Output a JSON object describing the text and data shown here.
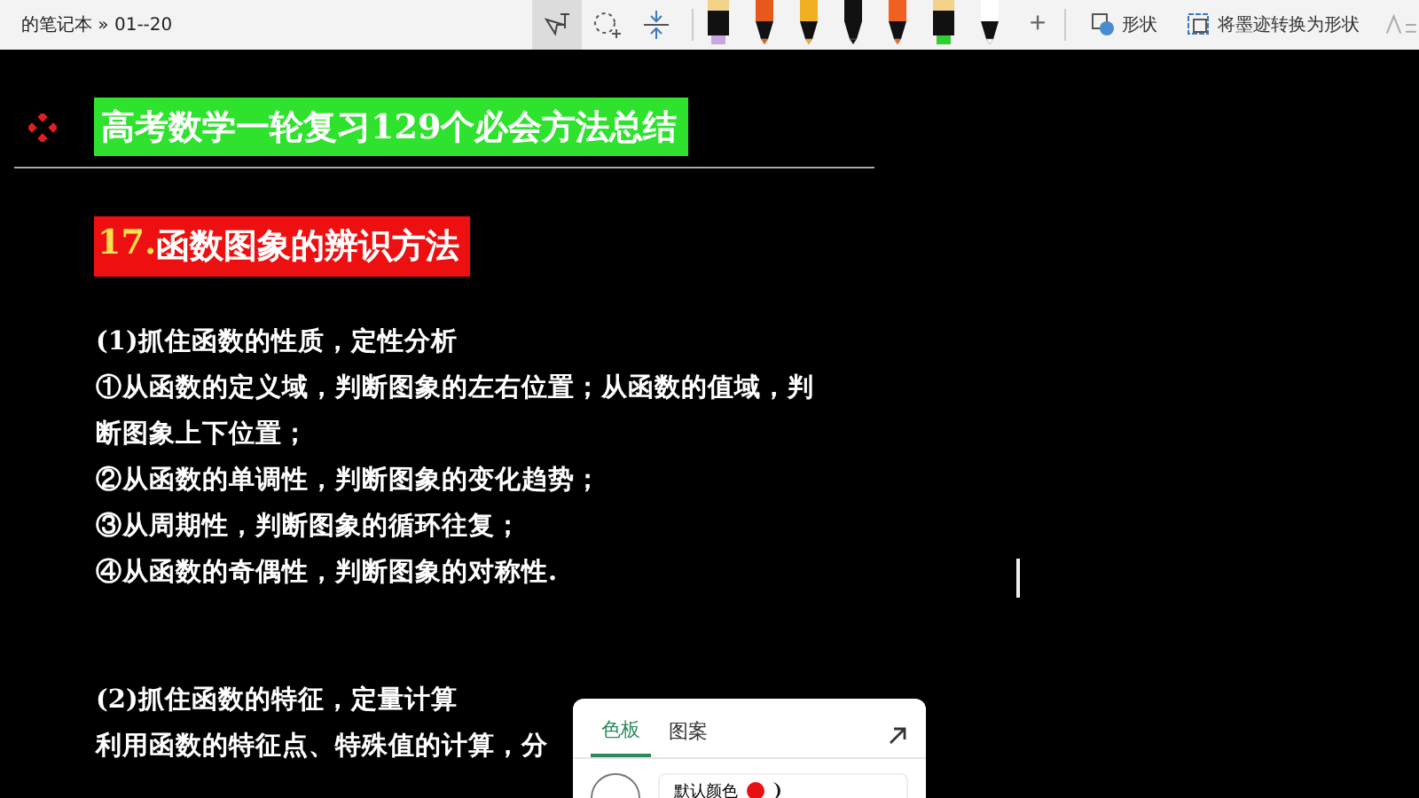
{
  "breadcrumb": "的笔记本 » 01--20",
  "tools": [
    {
      "kind": "ink-text",
      "selected": true
    },
    {
      "kind": "lasso",
      "selected": false
    },
    {
      "kind": "space",
      "selected": false
    }
  ],
  "pens": [
    {
      "kind": "highlighter",
      "color": "#c9a6e0"
    },
    {
      "kind": "pen",
      "color": "#e8581a"
    },
    {
      "kind": "pen",
      "color": "#f0b020"
    },
    {
      "kind": "pen",
      "color": "#111111"
    },
    {
      "kind": "pen",
      "color": "#f06020"
    },
    {
      "kind": "highlighter",
      "color": "#2ecf2e"
    },
    {
      "kind": "pen",
      "color": "#ffffff"
    }
  ],
  "add_pen": "+",
  "shape_button": "形状",
  "convert_button": "将墨迹转换为形状",
  "heading": "高考数学一轮复习129个必会方法总结",
  "section_number": "17.",
  "section_title": "函数图象的辨识方法",
  "blocks": [
    {
      "lines": [
        "(1)抓住函数的性质，定性分析",
        "①从函数的定义域，判断图象的左右位置；从函数的值域，判",
        "断图象上下位置；",
        "②从函数的单调性，判断图象的变化趋势；",
        "③从周期性，判断图象的循环往复；",
        "④从函数的奇偶性，判断图象的对称性."
      ]
    },
    {
      "lines": [
        "(2)抓住函数的特征，定量计算",
        "利用函数的特征点、特殊值的计算，分"
      ]
    }
  ],
  "popup": {
    "tabs": [
      {
        "label": "色板",
        "selected": true
      },
      {
        "label": "图案",
        "selected": false
      }
    ],
    "default_color_label": "默认颜色"
  }
}
